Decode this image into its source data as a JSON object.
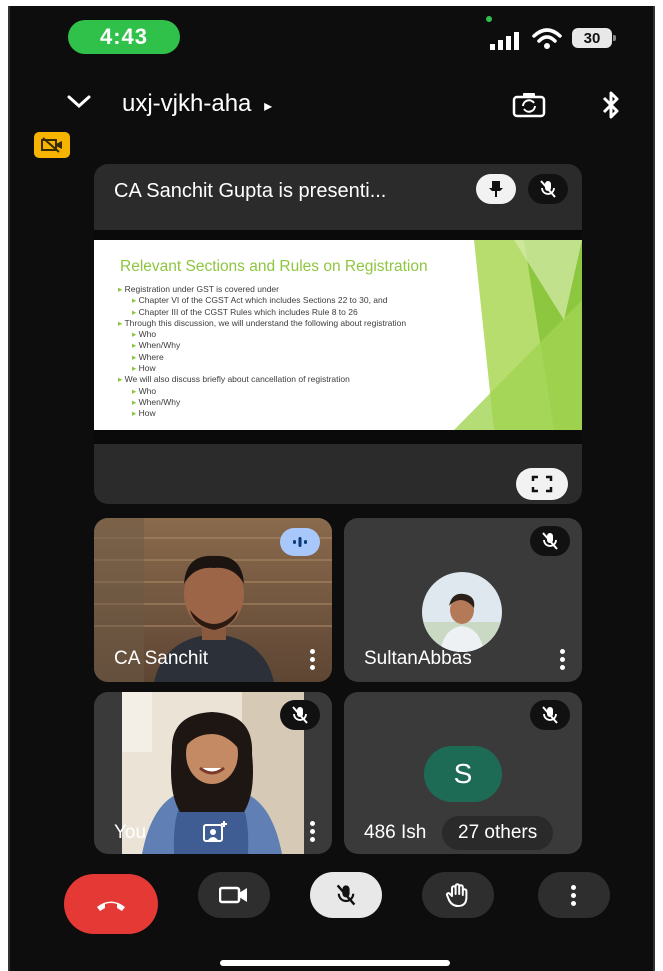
{
  "status_bar": {
    "time": "4:43",
    "battery": "30"
  },
  "header": {
    "meeting_code": "uxj-vjkh-aha",
    "meeting_code_arrow": "▸"
  },
  "presentation": {
    "banner": "CA Sanchit Gupta is presenti...",
    "slide": {
      "title": "Relevant Sections and Rules on Registration",
      "bullets": [
        "Registration under GST is covered under",
        "Chapter VI of the CGST Act which includes Sections 22 to 30, and",
        "Chapter III of the CGST Rules which includes Rule 8 to 26",
        "Through this discussion, we will understand the following about registration",
        "Who",
        "When/Why",
        "Where",
        "How",
        "We will also discuss briefly about cancellation of registration",
        "Who",
        "When/Why",
        "How"
      ]
    }
  },
  "participants": {
    "tile1": {
      "name": "CA Sanchit"
    },
    "tile2": {
      "name": "SultanAbbas"
    },
    "tile3": {
      "name": "You"
    },
    "tile4": {
      "name": "486 Ish",
      "avatar_letter": "S",
      "others_label": "27 others"
    }
  },
  "colors": {
    "end_call": "#e53935",
    "slide_green": "#8dc63f",
    "avatar_s": "#1e6b55",
    "time_pill": "#2fc14a"
  }
}
